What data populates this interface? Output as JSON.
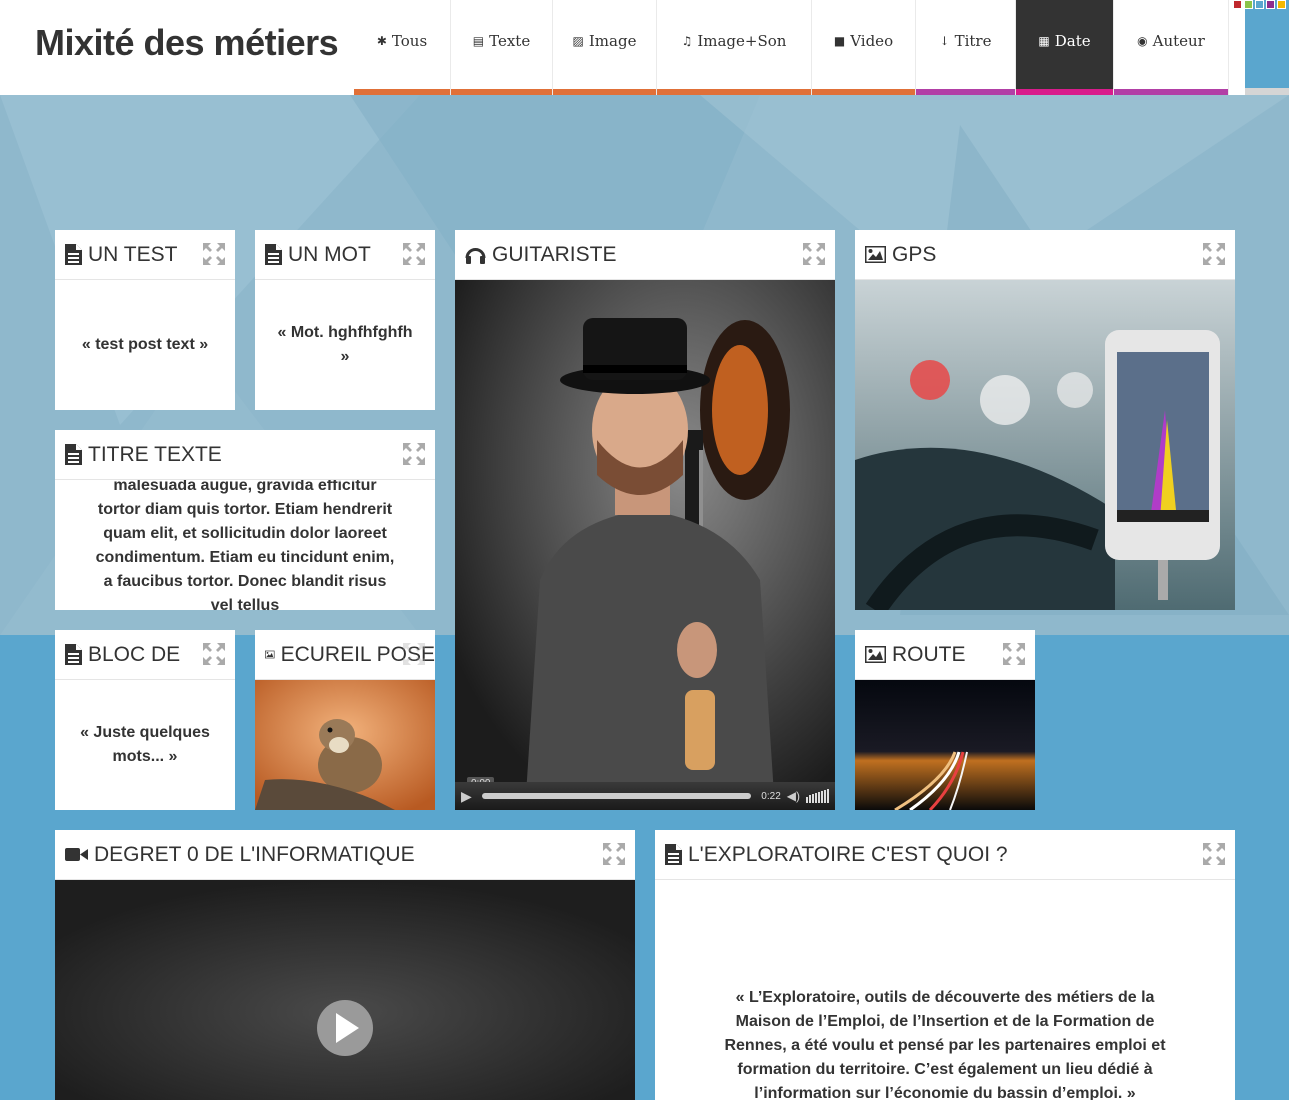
{
  "header": {
    "title": "Mixité des métiers",
    "nav": [
      {
        "label": "Tous",
        "icon": "asterisk-icon",
        "glyph": "✱",
        "width": 97,
        "bar_color": "#e07038",
        "active": false
      },
      {
        "label": "Texte",
        "icon": "document-icon",
        "glyph": "▤",
        "width": 102,
        "bar_color": "#e07038",
        "active": false
      },
      {
        "label": "Image",
        "icon": "image-icon",
        "glyph": "▨",
        "width": 104,
        "bar_color": "#e07038",
        "active": false
      },
      {
        "label": "Image+Son",
        "icon": "headphones-icon",
        "glyph": "♫",
        "width": 155,
        "bar_color": "#e07038",
        "active": false
      },
      {
        "label": "Video",
        "icon": "video-camera-icon",
        "glyph": "■",
        "width": 104,
        "bar_color": "#e07038",
        "active": false
      },
      {
        "label": "Titre",
        "icon": "sort-alpha-icon",
        "glyph": "↓",
        "width": 100,
        "bar_color": "#b23fa6",
        "active": false
      },
      {
        "label": "Date",
        "icon": "calendar-icon",
        "glyph": "▦",
        "width": 98,
        "bar_color": "#d81c8c",
        "active": true
      },
      {
        "label": "Auteur",
        "icon": "user-circle-icon",
        "glyph": "◉",
        "width": 115,
        "bar_color": "#b23fa6",
        "active": false
      }
    ],
    "theme_swatches": [
      "#c0282d",
      "#8bc34a",
      "#5aa6ce",
      "#8e2d8e",
      "#f3b800"
    ]
  },
  "cards": {
    "un_test": {
      "title": "UN TEST",
      "text": "« test post text »"
    },
    "un_mot": {
      "title": "UN MOT",
      "text": "« Mot. hghfhfghfh »"
    },
    "guitariste": {
      "title": "GUITARISTE",
      "time_tip": "0:00",
      "duration": "0:22"
    },
    "gps": {
      "title": "GPS"
    },
    "titre_texte": {
      "title": "TITRE TEXTE",
      "text": "malesuada augue, gravida efficitur tortor diam quis tortor. Etiam hendrerit quam elit, et sollicitudin dolor laoreet condimentum. Etiam eu tincidunt enim, a faucibus tortor. Donec blandit risus vel tellus"
    },
    "bloc_de": {
      "title": "BLOC DE",
      "text": "« Juste quelques mots... »"
    },
    "ecureil": {
      "title": "ECUREIL POSE"
    },
    "route": {
      "title": "ROUTE"
    },
    "degret": {
      "title": "DEGRET 0 DE L'INFORMATIQUE"
    },
    "exploratoire": {
      "title": "L'EXPLORATOIRE C'EST QUOI ?",
      "text": "« L’Exploratoire, outils de découverte des métiers de la Maison de l’Emploi, de l’Insertion et de la Formation de Rennes, a été voulu et pensé par les partenaires emploi et formation du territoire. C’est également un lieu dédié à l’information sur l’économie du bassin d’emploi. »"
    }
  }
}
